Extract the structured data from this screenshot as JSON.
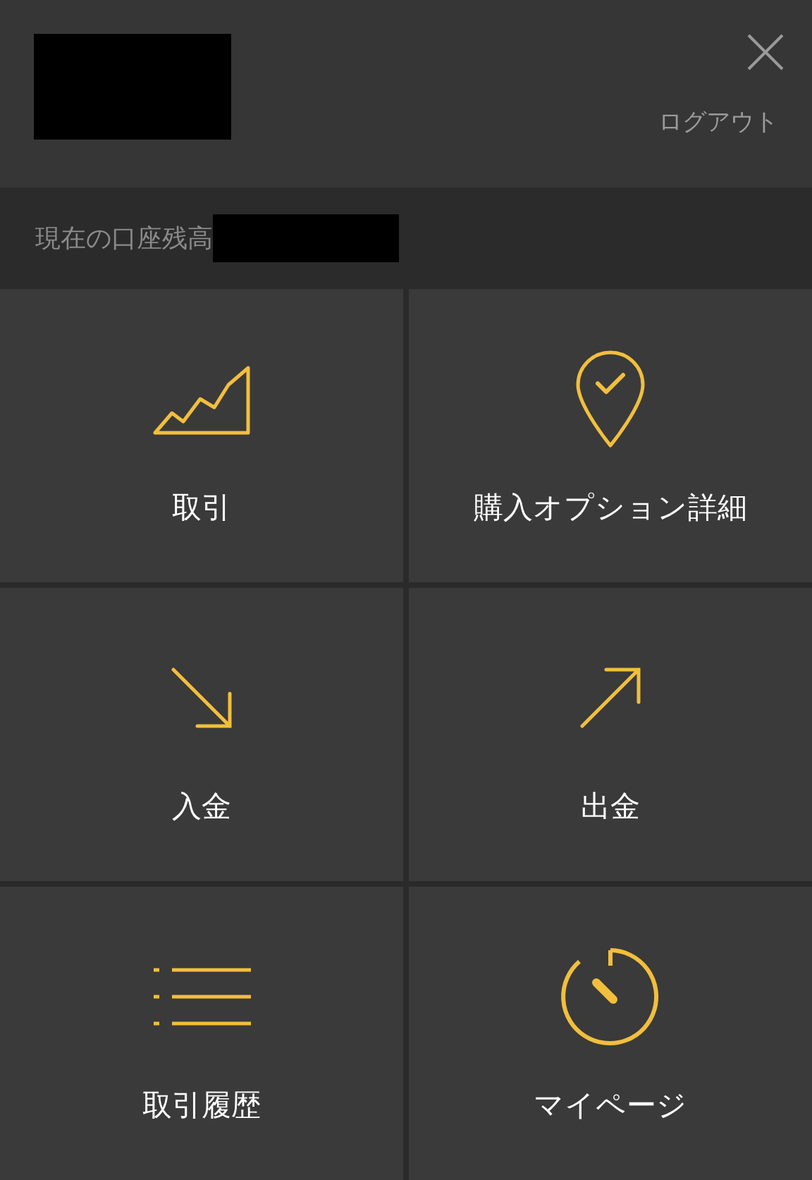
{
  "header": {
    "logout": "ログアウト"
  },
  "balance": {
    "label": "現在の口座残高"
  },
  "tiles": [
    {
      "label": "取引"
    },
    {
      "label": "購入オプション詳細"
    },
    {
      "label": "入金"
    },
    {
      "label": "出金"
    },
    {
      "label": "取引履歴"
    },
    {
      "label": "マイページ"
    }
  ]
}
